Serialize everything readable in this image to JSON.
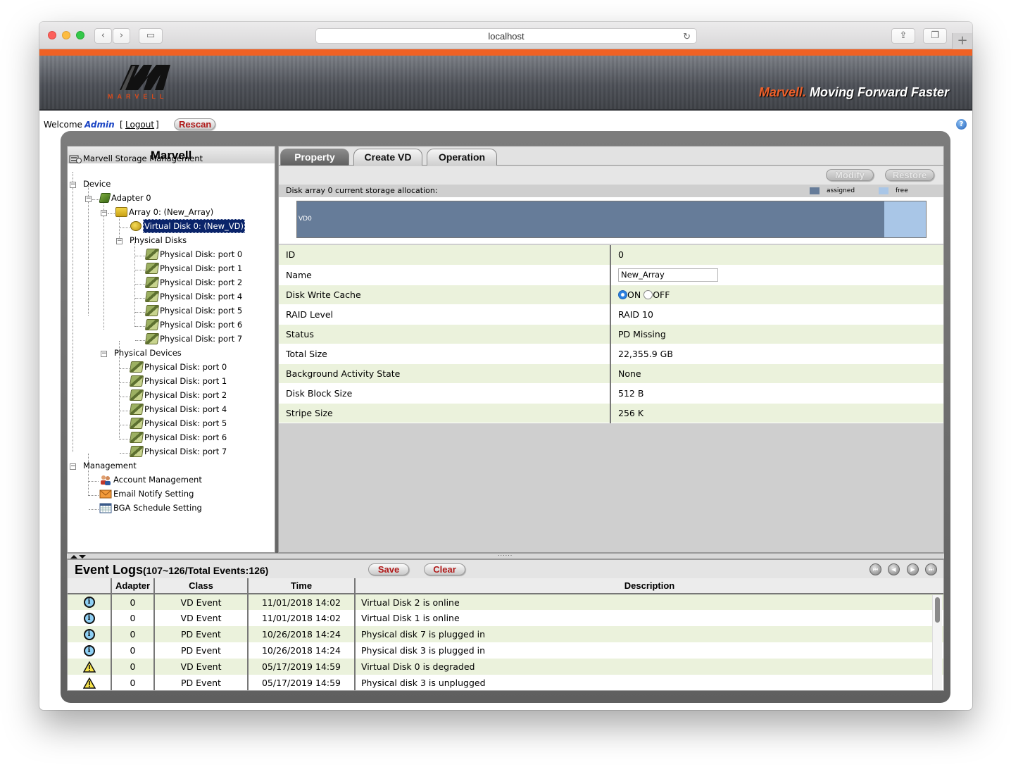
{
  "browser": {
    "url": "localhost",
    "back_glyph": "‹",
    "forward_glyph": "›",
    "sidebar_glyph": "▭",
    "reload_glyph": "↻",
    "share_glyph": "⇪",
    "tabs_glyph": "❐",
    "newtab_glyph": "+"
  },
  "header": {
    "logo_text": "MARVELL",
    "tagline_brand": "Marvell.",
    "tagline_rest": " Moving Forward Faster"
  },
  "welcome": {
    "welcome_label": "Welcome",
    "user": "Admin",
    "logout_open": "[",
    "logout": "Logout",
    "logout_close": "]",
    "rescan": "Rescan",
    "help_glyph": "?"
  },
  "tree": {
    "title": "Marvell",
    "root": "Marvell Storage Management",
    "device": "Device",
    "adapter": "Adapter 0",
    "array": "Array 0: (New_Array)",
    "virtual_disk": "Virtual Disk 0: (New_VD)",
    "physical_disks_group": "Physical Disks",
    "physical_disks": [
      "Physical Disk: port 0",
      "Physical Disk: port 1",
      "Physical Disk: port 2",
      "Physical Disk: port 4",
      "Physical Disk: port 5",
      "Physical Disk: port 6",
      "Physical Disk: port 7"
    ],
    "physical_devices_group": "Physical Devices",
    "physical_devices": [
      "Physical Disk: port 0",
      "Physical Disk: port 1",
      "Physical Disk: port 2",
      "Physical Disk: port 4",
      "Physical Disk: port 5",
      "Physical Disk: port 6",
      "Physical Disk: port 7"
    ],
    "management": "Management",
    "management_items": [
      "Account Management",
      "Email Notify Setting",
      "BGA Schedule Setting"
    ]
  },
  "tabs": [
    "Property",
    "Create VD",
    "Operation"
  ],
  "toolbar": {
    "modify": "Modify",
    "restore": "Restore"
  },
  "allocation": {
    "caption": "Disk array 0 current storage allocation:",
    "legend_assigned": "assigned",
    "legend_free": "free",
    "segment_label": "VD0",
    "assigned_fraction": 0.934,
    "assigned_color": "#667c99",
    "free_color": "#a9c6e7"
  },
  "properties": {
    "id_label": "ID",
    "id_value": "0",
    "name_label": "Name",
    "name_value": "New_Array",
    "cache_label": "Disk Write Cache",
    "cache_on": "ON",
    "cache_off": "OFF",
    "cache_selected": "ON",
    "raid_label": "RAID Level",
    "raid_value": "RAID 10",
    "status_label": "Status",
    "status_value": "PD Missing",
    "size_label": "Total Size",
    "size_value": "22,355.9 GB",
    "bga_label": "Background Activity State",
    "bga_value": "None",
    "block_label": "Disk Block Size",
    "block_value": "512 B",
    "stripe_label": "Stripe Size",
    "stripe_value": "256 K"
  },
  "logs": {
    "title": "Event Logs",
    "subtitle": "(107~126/Total Events:126)",
    "save": "Save",
    "clear": "Clear",
    "nav": {
      "first": "⏮",
      "prev": "◀",
      "next": "▶",
      "last": "⏭"
    },
    "columns": [
      "",
      "Adapter",
      "Class",
      "Time",
      "Description"
    ],
    "rows": [
      {
        "severity": "info-icon",
        "adapter": "0",
        "class": "VD Event",
        "time": "11/01/2018 14:02",
        "desc": "Virtual Disk 2 is online"
      },
      {
        "severity": "info-icon",
        "adapter": "0",
        "class": "VD Event",
        "time": "11/01/2018 14:02",
        "desc": "Virtual Disk 1 is online"
      },
      {
        "severity": "info-icon",
        "adapter": "0",
        "class": "PD Event",
        "time": "10/26/2018 14:24",
        "desc": "Physical disk 7 is plugged in"
      },
      {
        "severity": "info-icon",
        "adapter": "0",
        "class": "PD Event",
        "time": "10/26/2018 14:24",
        "desc": "Physical disk 3 is plugged in"
      },
      {
        "severity": "warning-icon",
        "adapter": "0",
        "class": "VD Event",
        "time": "05/17/2019 14:59",
        "desc": "Virtual Disk 0 is degraded"
      },
      {
        "severity": "warning-icon",
        "adapter": "0",
        "class": "PD Event",
        "time": "05/17/2019 14:59",
        "desc": "Physical disk 3 is unplugged"
      }
    ],
    "info_glyph": "i"
  },
  "colors": {
    "accent_orange": "#ef6124",
    "button_red": "#b01a1a",
    "row_green": "#ebf2dc",
    "tab_active": "#6f6f6f"
  }
}
